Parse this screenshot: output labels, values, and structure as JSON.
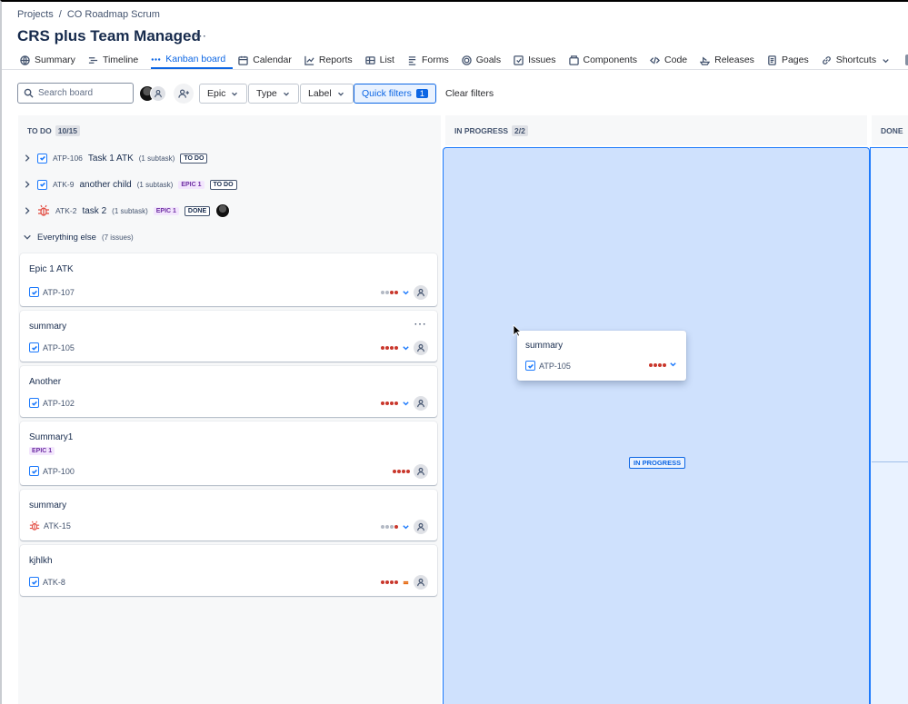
{
  "breadcrumb": [
    "Projects",
    "CO Roadmap Scrum"
  ],
  "breadcrumb_sep": "/",
  "title": "CRS plus Team Managed",
  "title_more": "⋯",
  "tabs": [
    {
      "label": "Summary",
      "icon": "globe-icon"
    },
    {
      "label": "Timeline",
      "icon": "timeline-icon"
    },
    {
      "label": "Kanban board",
      "icon": "board-icon",
      "active": true
    },
    {
      "label": "Calendar",
      "icon": "calendar-icon"
    },
    {
      "label": "Reports",
      "icon": "chart-icon"
    },
    {
      "label": "List",
      "icon": "list-icon"
    },
    {
      "label": "Forms",
      "icon": "forms-icon"
    },
    {
      "label": "Goals",
      "icon": "target-icon"
    },
    {
      "label": "Issues",
      "icon": "issues-icon"
    },
    {
      "label": "Components",
      "icon": "components-icon"
    },
    {
      "label": "Code",
      "icon": "code-icon"
    },
    {
      "label": "Releases",
      "icon": "ship-icon"
    },
    {
      "label": "Pages",
      "icon": "page-icon"
    },
    {
      "label": "Shortcuts",
      "icon": "link-icon"
    }
  ],
  "toolbar": {
    "search_placeholder": "Search board",
    "epic": "Epic",
    "type": "Type",
    "label": "Label",
    "quick_filters": "Quick filters",
    "quick_filters_count": "1",
    "clear_filters": "Clear filters"
  },
  "columns": {
    "todo": {
      "name": "TO DO",
      "count": "10/15"
    },
    "in_progress": {
      "name": "IN PROGRESS",
      "count": "2/2"
    },
    "done": {
      "name": "DONE"
    }
  },
  "swimlanes": [
    {
      "key": "ATP-106",
      "title": "Task 1 ATK",
      "sub": "(1 subtask)",
      "status": "TO DO"
    },
    {
      "key": "ATK-9",
      "title": "another child",
      "sub": "(1 subtask)",
      "epic": "EPIC 1",
      "status": "TO DO"
    },
    {
      "key": "ATK-2",
      "title": "task 2",
      "sub": "(1 subtask)",
      "epic": "EPIC 1",
      "status": "DONE"
    },
    {
      "title": "Everything else",
      "sub": "(7 issues)"
    }
  ],
  "cards": [
    {
      "title": "Epic 1 ATK",
      "key": "ATP-107",
      "type": "task",
      "priority": "low"
    },
    {
      "title": "summary",
      "key": "ATP-105",
      "type": "task",
      "priority": "high",
      "more": "⋯"
    },
    {
      "title": "Another",
      "key": "ATP-102",
      "type": "task",
      "priority": "high"
    },
    {
      "title": "Summary1",
      "key": "ATP-100",
      "type": "task",
      "epic": "EPIC 1",
      "priority": "high"
    },
    {
      "title": "summary",
      "key": "ATK-15",
      "type": "bug",
      "priority": "low"
    },
    {
      "title": "kjhlkh",
      "key": "ATK-8",
      "type": "task",
      "priority": "medium"
    }
  ],
  "drag_card": {
    "title": "summary",
    "key": "ATP-105"
  },
  "drop_label": "IN PROGRESS",
  "colors": {
    "accent": "#0c66e4",
    "drop_zone": "#cfe1fd",
    "epic_bg": "#f3e6fd",
    "priority_red": "#c9372c"
  }
}
